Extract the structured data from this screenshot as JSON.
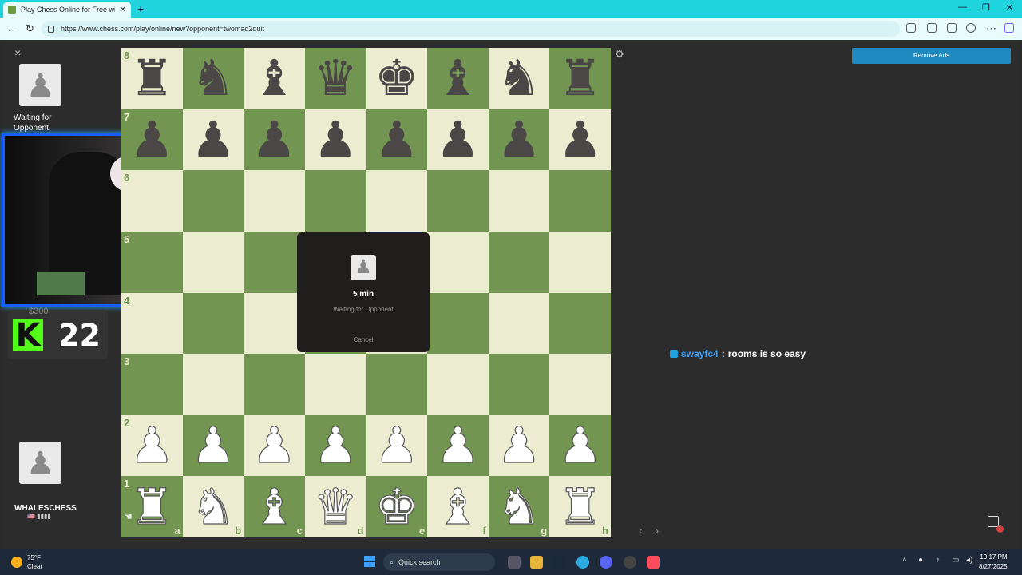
{
  "browser": {
    "tab_title": "Play Chess Online for Free with Fr",
    "tab_close": "✕",
    "new_tab": "+",
    "url": "https://www.chess.com/play/online/new?opponent=twomad2quit"
  },
  "left_panel": {
    "close": "×",
    "top_player_status": "Waiting for Opponent.",
    "bottom_player_name": "WHALESCHESS",
    "bottom_player_flag": "🇺🇸 ▮▮▮▮"
  },
  "kick": {
    "logo": "K",
    "count": "22",
    "top_text": "$300"
  },
  "board": {
    "ranks": [
      "8",
      "7",
      "6",
      "5",
      "4",
      "3",
      "2",
      "1"
    ],
    "files": [
      "a",
      "b",
      "c",
      "d",
      "e",
      "f",
      "g",
      "h"
    ],
    "rows": [
      [
        "♜",
        "♞",
        "♝",
        "♛",
        "♚",
        "♝",
        "♞",
        "♜"
      ],
      [
        "♟",
        "♟",
        "♟",
        "♟",
        "♟",
        "♟",
        "♟",
        "♟"
      ],
      [
        "",
        "",
        "",
        "",
        "",
        "",
        "",
        ""
      ],
      [
        "",
        "",
        "",
        "",
        "",
        "",
        "",
        ""
      ],
      [
        "",
        "",
        "",
        "",
        "",
        "",
        "",
        ""
      ],
      [
        "",
        "",
        "",
        "",
        "",
        "",
        "",
        ""
      ],
      [
        "♟",
        "♟",
        "♟",
        "♟",
        "♟",
        "♟",
        "♟",
        "♟"
      ],
      [
        "♜",
        "♞",
        "♝",
        "♛",
        "♚",
        "♝",
        "♞",
        "♜"
      ]
    ],
    "colors": [
      "b",
      "b",
      "",
      "",
      "",
      "",
      "w",
      "w"
    ]
  },
  "modal": {
    "time_control": "5 min",
    "status": "Waiting for Opponent",
    "cancel": "Cancel"
  },
  "right": {
    "remove_ads": "Remove Ads",
    "chat_user": "swayfc4",
    "chat_sep": ":",
    "chat_msg": "rooms is so easy"
  },
  "taskbar": {
    "temp": "75°F",
    "weather": "Clear",
    "search": "Quick search",
    "time": "10:17 PM",
    "date": "8/27/2025"
  },
  "colors": {
    "light_square": "#ebecd0",
    "dark_square": "#739552",
    "remove_ads_bg": "#1f8ac0",
    "tab_strip": "#1fd4dc"
  }
}
